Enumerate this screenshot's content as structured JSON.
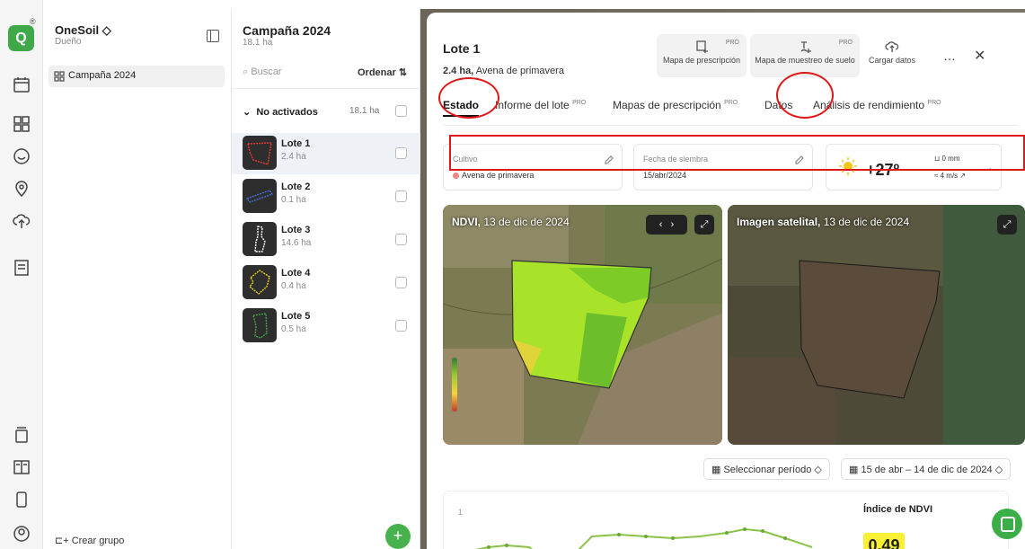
{
  "org": {
    "name": "OneSoil",
    "role": "Dueño",
    "logo": "Q",
    "badge": "®"
  },
  "sidebar": {
    "campaign": "Campaña 2024",
    "new_group": "Crear grupo"
  },
  "campaign": {
    "title": "Campaña 2024",
    "area": "18.1 ha",
    "search_placeholder": "Buscar",
    "sort": "Ordenar",
    "group_label": "No activados",
    "group_area": "18.1 ha"
  },
  "fields": [
    {
      "name": "Lote 1",
      "area": "2.4 ha",
      "color": "#e53935"
    },
    {
      "name": "Lote 2",
      "area": "0.1 ha",
      "color": "#3f6fd8"
    },
    {
      "name": "Lote 3",
      "area": "14.6 ha",
      "color": "#ffffff"
    },
    {
      "name": "Lote 4",
      "area": "0.4 ha",
      "color": "#e8d21a"
    },
    {
      "name": "Lote 5",
      "area": "0.5 ha",
      "color": "#43a047"
    }
  ],
  "lot": {
    "title": "Lote 1",
    "area": "2.4 ha,",
    "crop_sub": "Avena de primavera",
    "actions": {
      "prescription": "Mapa de prescripción",
      "soil": "Mapa de muestreo de suelo",
      "upload": "Cargar datos",
      "pro": "PRO",
      "more": "…",
      "close": "✕"
    },
    "tabs": [
      {
        "label": "Estado",
        "pro": ""
      },
      {
        "label": "Informe del lote",
        "pro": "PRO"
      },
      {
        "label": "Mapas de prescripción",
        "pro": "PRO"
      },
      {
        "label": "Datos",
        "pro": ""
      },
      {
        "label": "Análisis de rendimiento",
        "pro": "PRO"
      }
    ],
    "crop_label": "Cultivo",
    "crop_value": "Avena de primavera",
    "sow_label": "Fecha de siembra",
    "sow_value": "15/abr/2024",
    "weather": {
      "temp": "+27º",
      "rain": "0 mm",
      "wind": "4 m/s ↗"
    },
    "ndvi_map_label": "NDVI,",
    "ndvi_map_date": "13 de dic de 2024",
    "sat_map_label": "Imagen satelital,",
    "sat_map_date": "13 de dic de 2024",
    "period_select": "Seleccionar período",
    "date_range": "15 de abr – 14 de dic de 2024",
    "chart_title": "Índice de NDVI",
    "ndvi_value": "0.49",
    "y_tick": "1"
  }
}
